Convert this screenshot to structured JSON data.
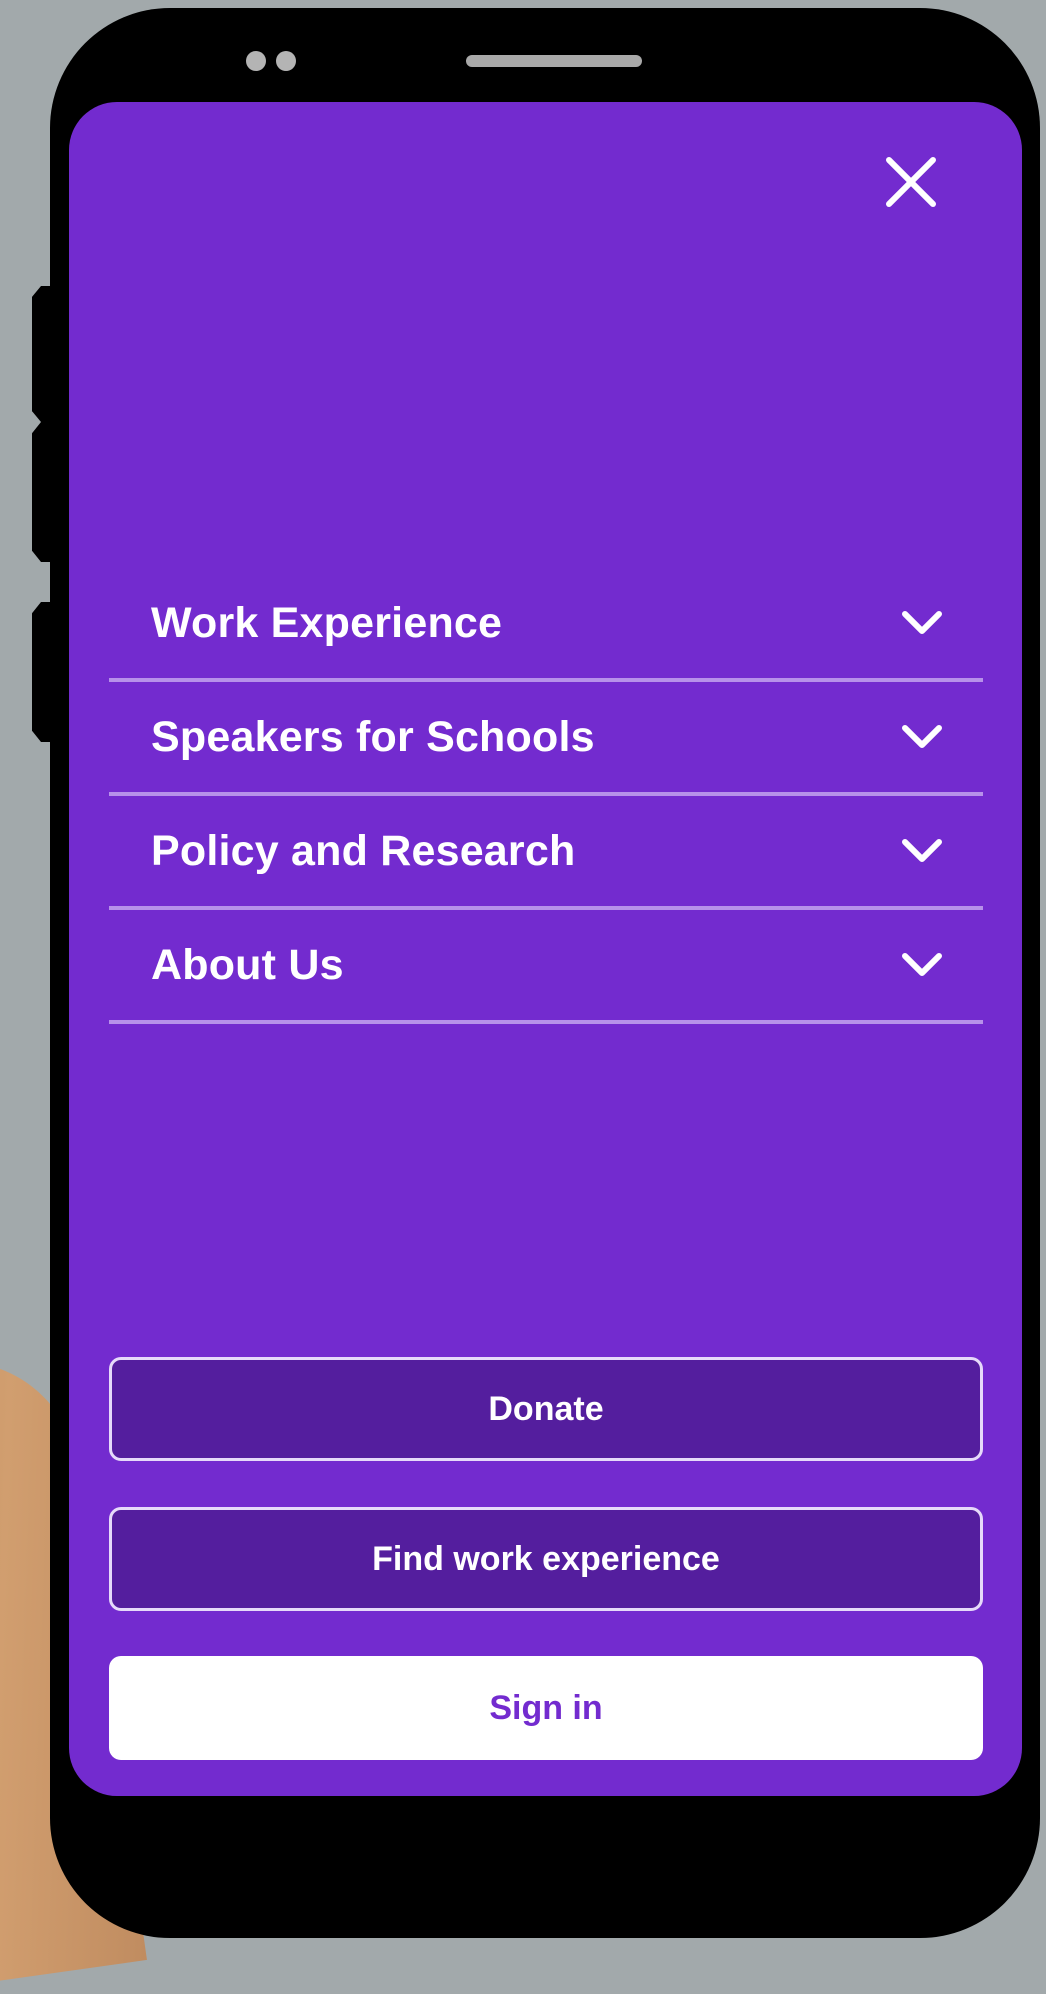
{
  "colors": {
    "screen_background": "#732bcf",
    "menu_divider": "#b791ea",
    "outline_button_fill": "#541e9e",
    "signin_text": "#732bcf"
  },
  "nav": {
    "close_icon": "close-icon",
    "items": [
      {
        "label": "Work Experience",
        "icon": "chevron-down-icon"
      },
      {
        "label": "Speakers for Schools",
        "icon": "chevron-down-icon"
      },
      {
        "label": "Policy and Research",
        "icon": "chevron-down-icon"
      },
      {
        "label": "About Us",
        "icon": "chevron-down-icon"
      }
    ]
  },
  "actions": {
    "donate_label": "Donate",
    "find_work_label": "Find work experience",
    "signin_label": "Sign in"
  }
}
